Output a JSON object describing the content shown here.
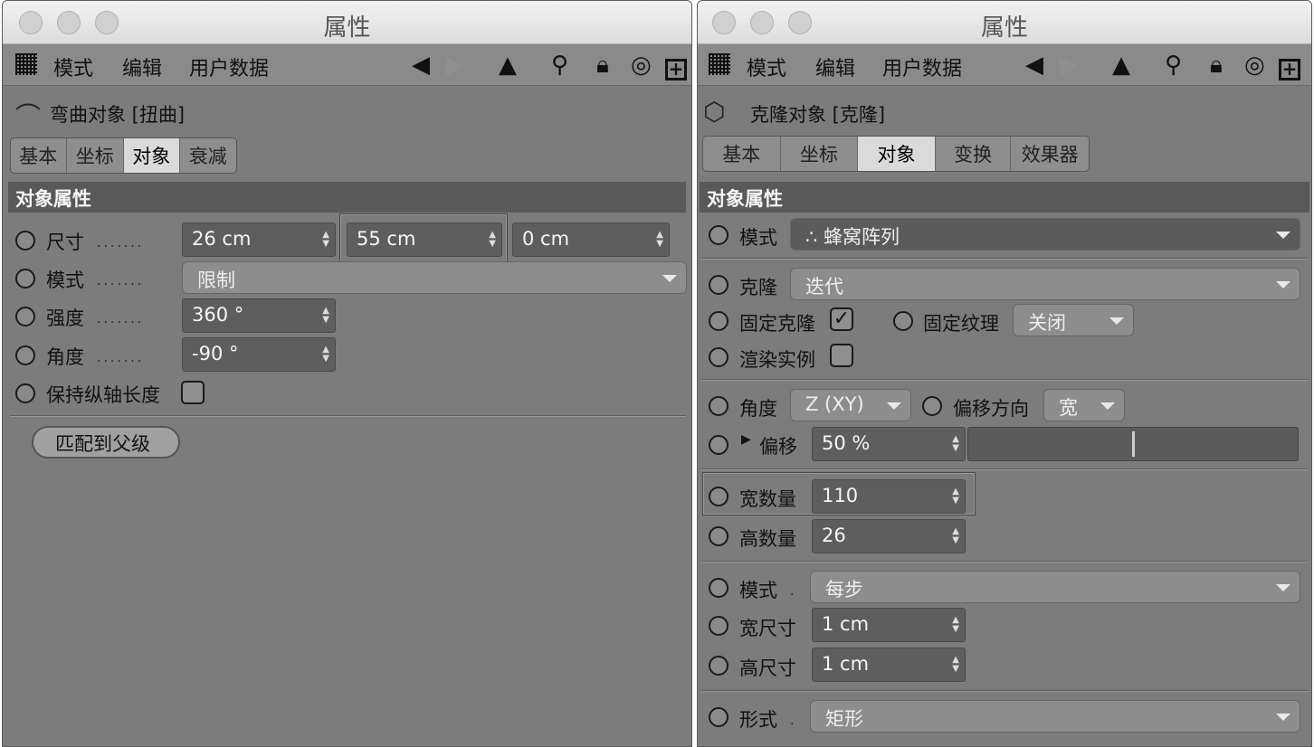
{
  "left": {
    "window_title": "属性",
    "menu": [
      "模式",
      "编辑",
      "用户数据"
    ],
    "object_title": "弯曲对象 [扭曲]",
    "tabs": [
      "基本",
      "坐标",
      "对象",
      "衰减"
    ],
    "active_tab": "对象",
    "section_title": "对象属性",
    "size_label": "尺寸",
    "size_values": [
      "26 cm",
      "55 cm",
      "0 cm"
    ],
    "mode_label": "模式",
    "mode_value": "限制",
    "strength_label": "强度",
    "strength_value": "360 °",
    "angle_label": "角度",
    "angle_value": "-90 °",
    "keep_length_label": "保持纵轴长度",
    "fit_parent_label": "匹配到父级"
  },
  "right": {
    "window_title": "属性",
    "menu": [
      "模式",
      "编辑",
      "用户数据"
    ],
    "object_title": "克隆对象 [克隆]",
    "tabs": [
      "基本",
      "坐标",
      "对象",
      "变换",
      "效果器"
    ],
    "active_tab": "对象",
    "section_title": "对象属性",
    "mode_label": "模式",
    "mode_value": "蜂窝阵列",
    "clone_label": "克隆",
    "clone_value": "迭代",
    "fix_clone_label": "固定克隆",
    "fix_texture_label": "固定纹理",
    "fix_texture_value": "关闭",
    "render_instance_label": "渲染实例",
    "angle_label": "角度",
    "angle_value": "Z (XY)",
    "offset_dir_label": "偏移方向",
    "offset_dir_value": "宽",
    "offset_label": "偏移",
    "offset_value": "50 %",
    "offset_fraction": 0.5,
    "width_count_label": "宽数量",
    "width_count_value": "110",
    "height_count_label": "高数量",
    "height_count_value": "26",
    "mode2_label": "模式",
    "mode2_value": "每步",
    "width_size_label": "宽尺寸",
    "width_size_value": "1 cm",
    "height_size_label": "高尺寸",
    "height_size_value": "1 cm",
    "form_label": "形式",
    "form_value": "矩形"
  }
}
